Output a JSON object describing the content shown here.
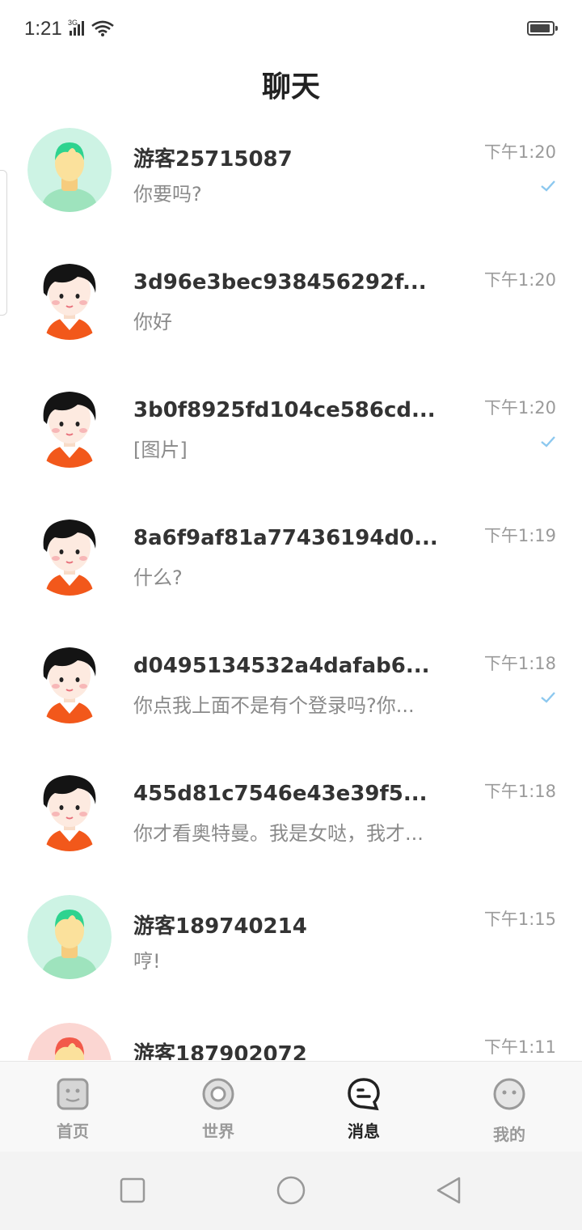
{
  "status_bar": {
    "time": "1:21",
    "network": "3G"
  },
  "header": {
    "title": "聊天"
  },
  "chats": [
    {
      "name": "游客25715087",
      "preview": "你要吗?",
      "time": "下午1:20",
      "read": true,
      "avatar": "guest-green-avatar"
    },
    {
      "name": "3d96e3bec938456292f...",
      "preview": "你好",
      "time": "下午1:20",
      "read": false,
      "avatar": "girl-avatar"
    },
    {
      "name": "3b0f8925fd104ce586cd...",
      "preview": "[图片]",
      "time": "下午1:20",
      "read": true,
      "avatar": "girl-avatar"
    },
    {
      "name": "8a6f9af81a77436194d0...",
      "preview": "什么?",
      "time": "下午1:19",
      "read": false,
      "avatar": "girl-avatar"
    },
    {
      "name": "d0495134532a4dafab6...",
      "preview": "你点我上面不是有个登录吗?你...",
      "time": "下午1:18",
      "read": true,
      "avatar": "girl-avatar"
    },
    {
      "name": "455d81c7546e43e39f5...",
      "preview": "你才看奥特曼。我是女哒，我才...",
      "time": "下午1:18",
      "read": false,
      "avatar": "girl-avatar"
    },
    {
      "name": "游客189740214",
      "preview": "哼!",
      "time": "下午1:15",
      "read": false,
      "avatar": "guest-green-avatar"
    },
    {
      "name": "游客187902072",
      "preview": "",
      "time": "下午1:11",
      "read": false,
      "avatar": "guest-red-avatar"
    }
  ],
  "tabs": [
    {
      "label": "首页",
      "icon": "home-face-icon",
      "active": false
    },
    {
      "label": "世界",
      "icon": "world-ring-icon",
      "active": false
    },
    {
      "label": "消息",
      "icon": "message-bubble-icon",
      "active": true
    },
    {
      "label": "我的",
      "icon": "profile-face-icon",
      "active": false
    }
  ],
  "colors": {
    "check": "#8cc8ef",
    "active_tab": "#222222",
    "inactive_tab": "#9a9a9a"
  }
}
